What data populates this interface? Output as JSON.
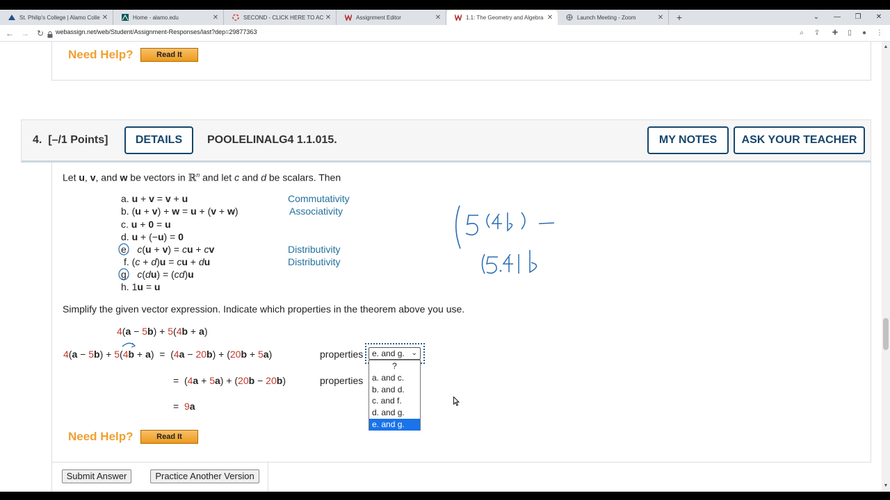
{
  "browser": {
    "tabs": [
      {
        "label": "St. Philip's College | Alamo Colle",
        "icon": "college-icon"
      },
      {
        "label": "Home - alamo.edu",
        "icon": "alamo-icon"
      },
      {
        "label": "SECOND - CLICK HERE TO ACCES",
        "icon": "loading-icon"
      },
      {
        "label": "Assignment Editor",
        "icon": "webassign-icon"
      },
      {
        "label": "1.1: The Geometry and Algebra o",
        "icon": "webassign-icon"
      },
      {
        "label": "Launch Meeting - Zoom",
        "icon": "globe-icon"
      }
    ],
    "active_tab": 4,
    "url": "webassign.net/web/Student/Assignment-Responses/last?dep=29877363",
    "close_glyph": "✕",
    "newtab_glyph": "+"
  },
  "prev_question": {
    "need_help": "Need Help?",
    "read_it": "Read It"
  },
  "question": {
    "number": "4.",
    "points": "[–/1 Points]",
    "details": "DETAILS",
    "code": "POOLELINALG4 1.1.015.",
    "my_notes": "MY NOTES",
    "ask_teacher": "ASK YOUR TEACHER"
  },
  "theorem": {
    "intro_a": "Let ",
    "intro_b": " be vectors in ",
    "intro_c": " and let ",
    "intro_d": " be scalars. Then",
    "items": [
      {
        "letter": "a.",
        "property": "Commutativity"
      },
      {
        "letter": "b.",
        "property": "Associativity"
      },
      {
        "letter": "c.",
        "property": ""
      },
      {
        "letter": "d.",
        "property": ""
      },
      {
        "letter": "e.",
        "property": "Distributivity"
      },
      {
        "letter": "f.",
        "property": "Distributivity"
      },
      {
        "letter": "g.",
        "property": ""
      },
      {
        "letter": "h.",
        "property": ""
      }
    ]
  },
  "instructions": "Simplify the given vector expression. Indicate which properties in the theorem above you use.",
  "properties_label": "properties",
  "select": {
    "value": "e. and g.",
    "options": [
      "?",
      "a. and c.",
      "b. and d.",
      "c. and f.",
      "d. and g.",
      "e. and g."
    ],
    "selected_index": 5
  },
  "need_help": "Need Help?",
  "read_it": "Read It",
  "buttons": {
    "submit": "Submit Answer",
    "practice": "Practice Another Version"
  },
  "colors": {
    "accent": "#16466b",
    "property_text": "#24709e",
    "red_number": "#c0392b",
    "help_orange": "#f0a030",
    "ink": "#2a6bb0"
  }
}
